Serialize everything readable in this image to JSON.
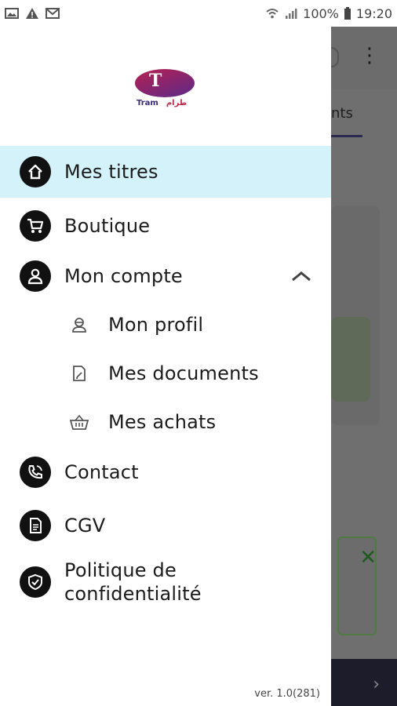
{
  "status_bar": {
    "battery": "100%",
    "time": "19:20"
  },
  "background_app": {
    "tab_fragment": "nts",
    "kebab": "⋮",
    "close_glyph": "✕",
    "chevron": "›"
  },
  "drawer": {
    "items": [
      {
        "label": "Mes titres"
      },
      {
        "label": "Boutique"
      },
      {
        "label": "Mon compte"
      },
      {
        "label": "Mon profil"
      },
      {
        "label": "Mes documents"
      },
      {
        "label": "Mes achats"
      },
      {
        "label": "Contact"
      },
      {
        "label": "CGV"
      },
      {
        "label": "Politique de confidentialité",
        "line1": "Politique de",
        "line2": "confidentialité"
      }
    ],
    "version": "ver. 1.0(281)"
  },
  "colors": {
    "active_bg": "#d4f2fa",
    "icon_circle": "#111111",
    "text": "#1b1b1b"
  }
}
